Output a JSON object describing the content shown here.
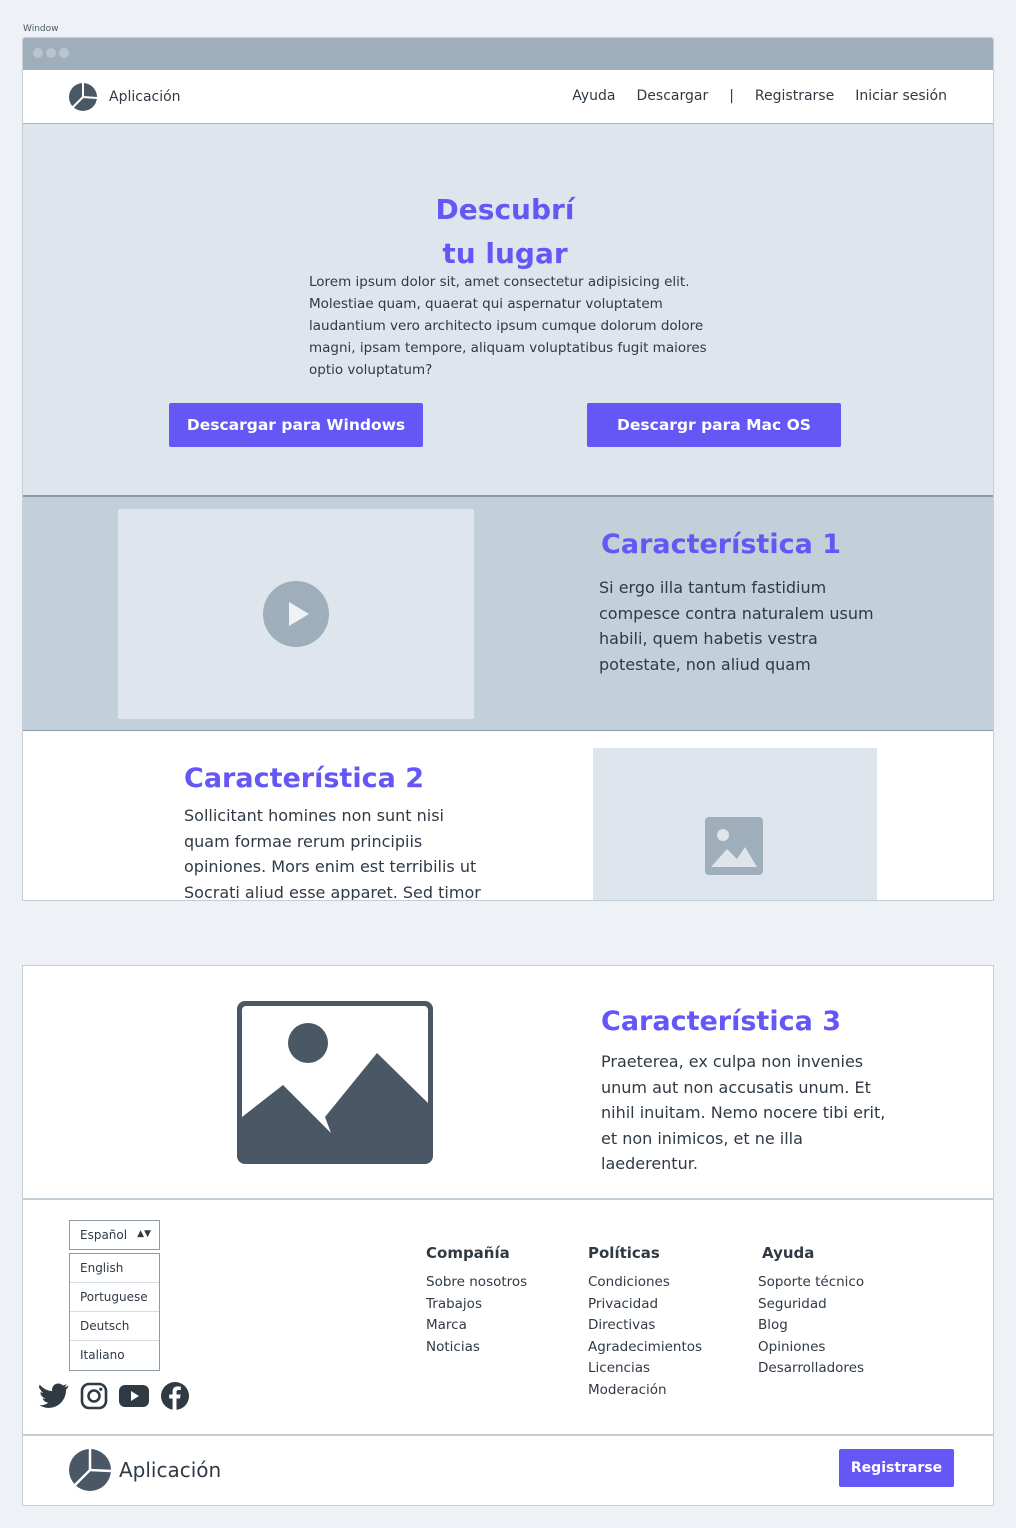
{
  "window": {
    "caption": "Window"
  },
  "nav": {
    "brand": "Aplicación",
    "links": [
      "Ayuda",
      "Descargar",
      "|",
      "Registrarse",
      "Iniciar sesión"
    ]
  },
  "hero": {
    "title": "Descubrí tu lugar",
    "body": "Lorem ipsum dolor sit, amet consectetur adipisicing elit. Molestiae quam, quaerat qui aspernatur voluptatem laudantium vero architecto ipsum cumque dolorum dolore magni, ipsam tempore, aliquam voluptatibus fugit maiores optio voluptatum?",
    "btn_windows": "Descargar para Windows",
    "btn_mac": "Descargr para Mac OS"
  },
  "feature1": {
    "title": "Característica 1",
    "body": "Si ergo illa tantum fastidium compesce contra naturalem usum habili, quem habetis vestra potestate, non aliud quam"
  },
  "feature2": {
    "title": "Característica 2",
    "body": "Sollicitant homines non sunt nisi quam formae rerum principiis opiniones. Mors enim est terribilis ut Socrati aliud esse apparet. Sed timor"
  },
  "feature3": {
    "title": "Característica 3",
    "body": "Praeterea, ex culpa non invenies unum aut non accusatis unum. Et nihil inuitam. Nemo nocere tibi erit, et non inimicos, et ne illa laederentur."
  },
  "footer": {
    "language_selected": "Español",
    "languages": [
      "English",
      "Portuguese",
      "Deutsch",
      "Italiano"
    ],
    "columns": [
      {
        "title": "Compañía",
        "items": [
          "Sobre nosotros",
          "Trabajos",
          "Marca",
          "Noticias"
        ]
      },
      {
        "title": "Políticas",
        "items": [
          "Condiciones",
          "Privacidad",
          "Directivas",
          "Agradecimientos",
          "Licencias",
          "Moderación"
        ]
      },
      {
        "title": "Ayuda",
        "items": [
          "Soporte técnico",
          "Seguridad",
          "Blog",
          "Opiniones",
          "Desarrolladores"
        ]
      }
    ],
    "socials": [
      "twitter-icon",
      "instagram-icon",
      "youtube-icon",
      "facebook-icon"
    ]
  },
  "bottom": {
    "brand": "Aplicación",
    "register_button": "Registrarse"
  },
  "colors": {
    "accent": "#6457f5",
    "text": "#2f3a45",
    "muted": "#9eaebb"
  }
}
